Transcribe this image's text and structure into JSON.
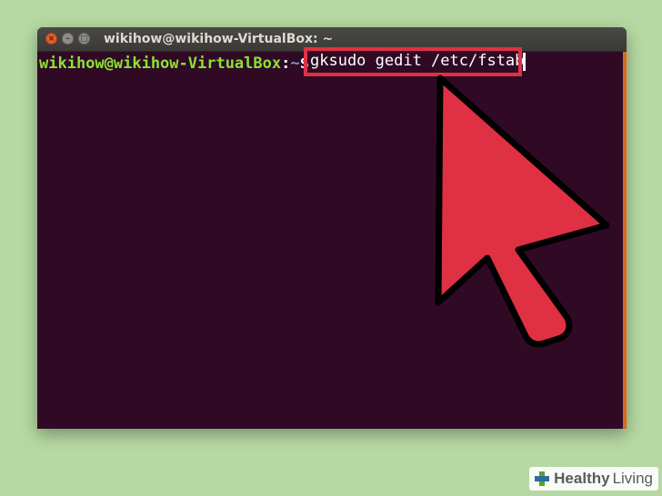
{
  "window": {
    "title": "wikihow@wikihow-VirtualBox: ~",
    "close_glyph": "×",
    "min_glyph": "–",
    "max_glyph": "□"
  },
  "terminal": {
    "user_host": "wikihow@wikihow-VirtualBox",
    "colon": ":",
    "path": "~",
    "dollar": "$",
    "command": "gksudo gedit /etc/fstab"
  },
  "colors": {
    "background": "#b6d9a3",
    "terminal_bg": "#300a24",
    "prompt_user": "#8ae234",
    "prompt_path": "#729fcf",
    "highlight": "#df3143"
  },
  "watermark": {
    "word1": "Healthy",
    "word2": "Living",
    "icon": "medical-cross-icon"
  }
}
